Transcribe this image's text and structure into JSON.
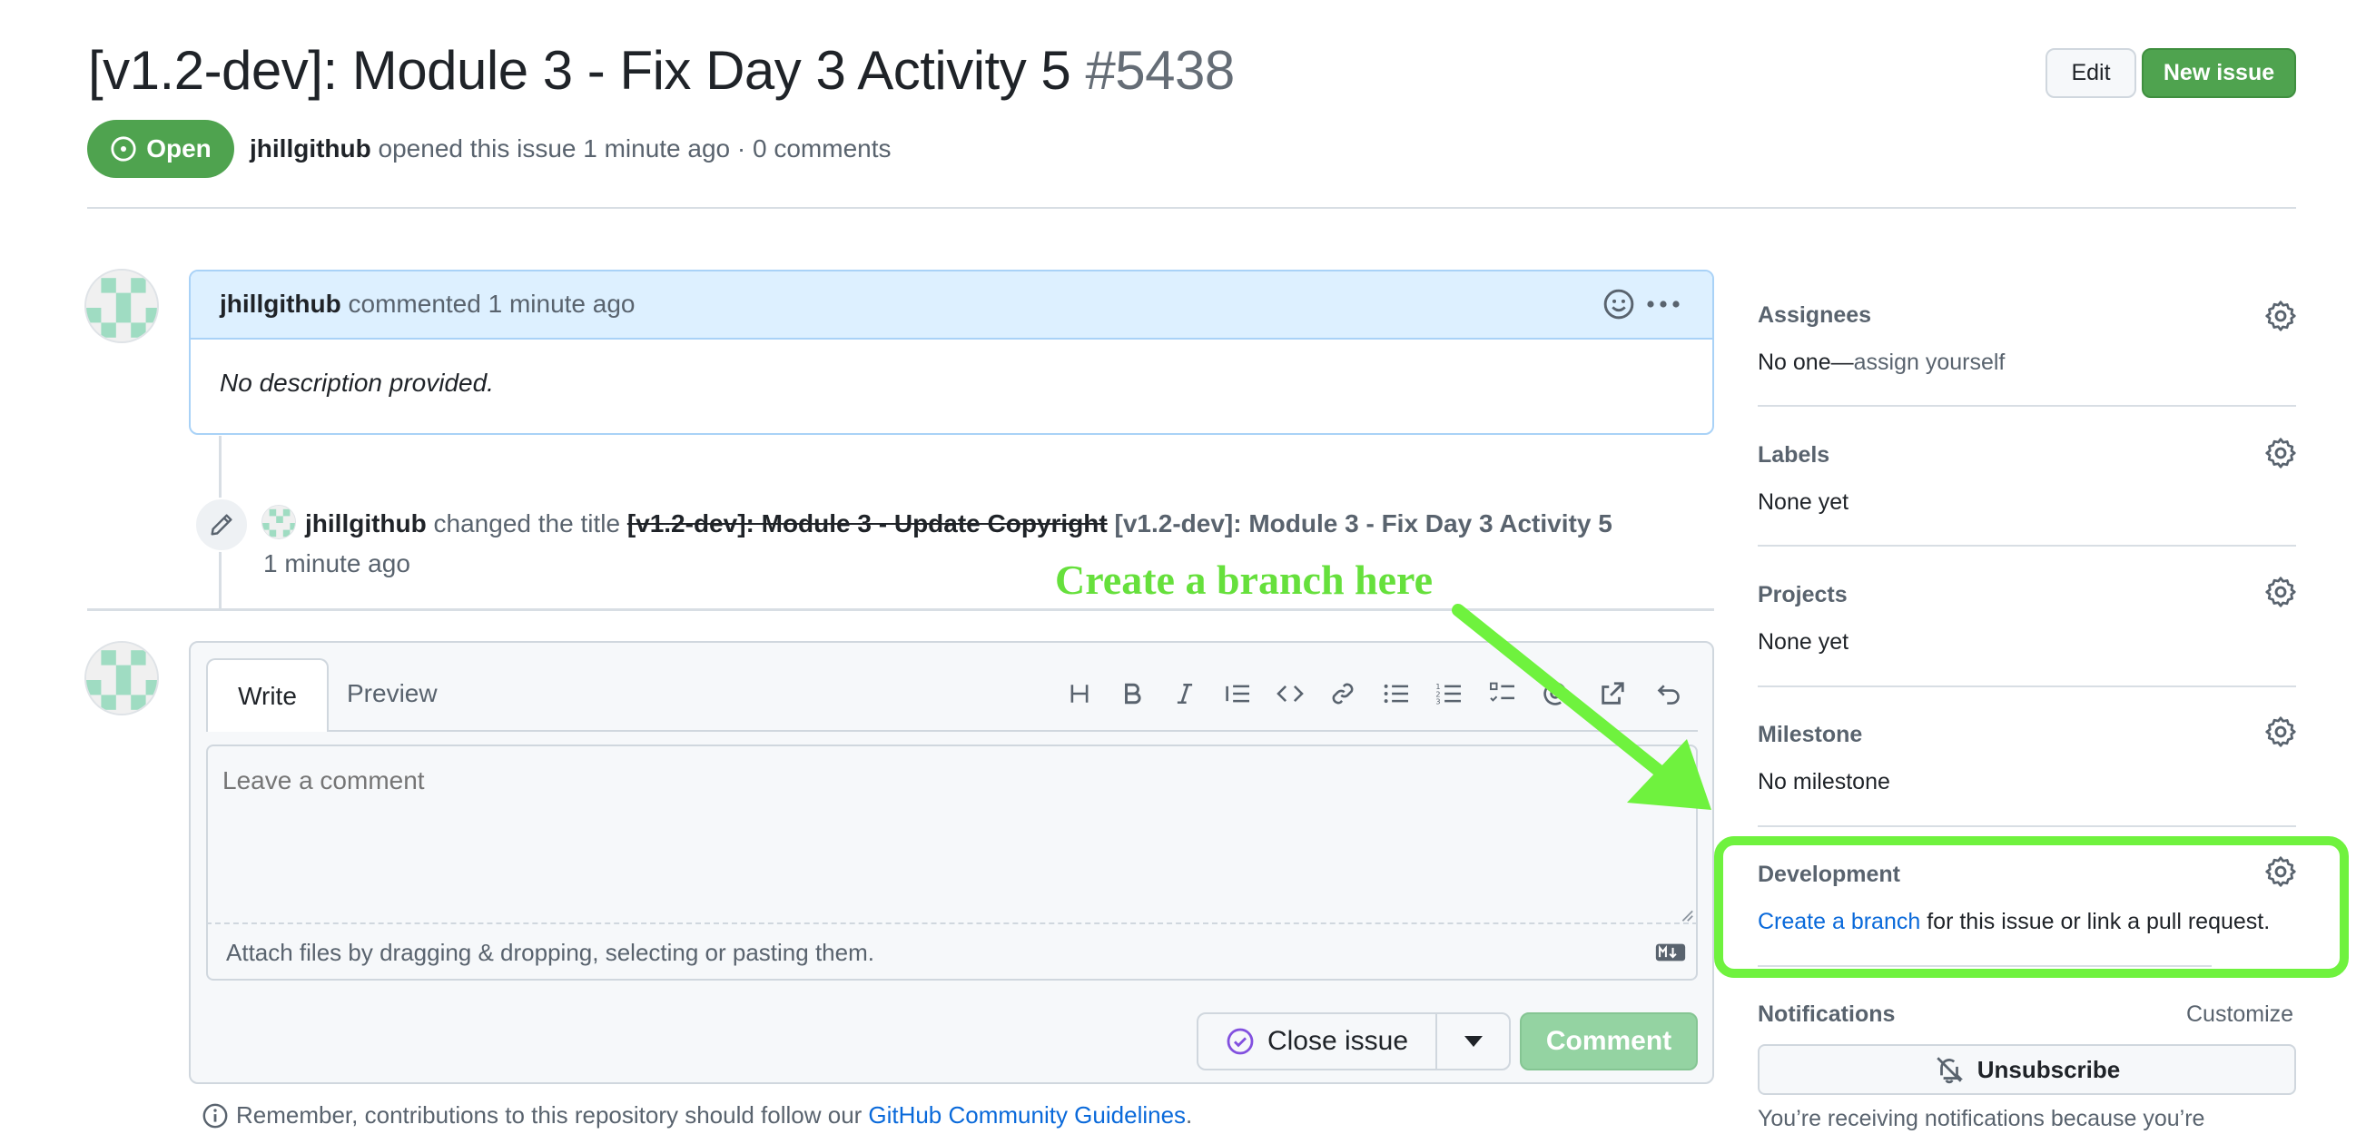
{
  "issue": {
    "title": "[v1.2-dev]: Module 3 - Fix Day 3 Activity 5",
    "number": "#5438",
    "state": "Open",
    "author": "jhillgithub",
    "opened_text": "opened this issue 1 minute ago · 0 comments"
  },
  "header": {
    "edit_label": "Edit",
    "new_issue_label": "New issue"
  },
  "comment": {
    "author": "jhillgithub",
    "meta": "commented 1 minute ago",
    "body": "No description provided."
  },
  "timeline": {
    "author": "jhillgithub",
    "action": "changed the title",
    "old_title": "[v1.2-dev]: Module 3 - Update Copyright",
    "new_title": "[v1.2-dev]: Module 3 - Fix Day 3 Activity 5",
    "time": "1 minute ago"
  },
  "editor": {
    "tab_write": "Write",
    "tab_preview": "Preview",
    "placeholder": "Leave a comment",
    "attach_text": "Attach files by dragging & dropping, selecting or pasting them.",
    "close_label": "Close issue",
    "comment_label": "Comment",
    "guidelines_prefix": "Remember, contributions to this repository should follow our",
    "guidelines_link": "GitHub Community Guidelines",
    "guidelines_suffix": ".",
    "toolbar": [
      "heading-icon",
      "bold-icon",
      "italic-icon",
      "quote-icon",
      "code-icon",
      "link-icon",
      "bulleted-list-icon",
      "numbered-list-icon",
      "task-list-icon",
      "mention-icon",
      "reference-icon",
      "undo-icon"
    ]
  },
  "sidebar": {
    "assignees_title": "Assignees",
    "assignees_prefix": "No one—",
    "assignees_link": "assign yourself",
    "labels_title": "Labels",
    "labels_value": "None yet",
    "projects_title": "Projects",
    "projects_value": "None yet",
    "milestone_title": "Milestone",
    "milestone_value": "No milestone",
    "development_title": "Development",
    "development_link": "Create a branch",
    "development_suffix": "for this issue or link a pull request.",
    "notifications_title": "Notifications",
    "customize_label": "Customize",
    "unsubscribe_label": "Unsubscribe",
    "notifications_text": "You’re receiving notifications because you’re"
  },
  "annotation": {
    "text": "Create a branch here",
    "color": "#66e03c"
  },
  "colors": {
    "open_green": "#4fa34f",
    "link_blue": "#0969da"
  }
}
